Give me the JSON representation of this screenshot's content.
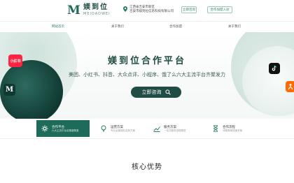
{
  "header": {
    "logo_mark": "M",
    "logo_cn": "媄到位",
    "logo_en": "MEIDAOWEI",
    "address_line1": "江西省吉安市新区",
    "address_line2": "吉安市媄到位信息科技有限公司",
    "btn_a": "立即咨询",
    "btn_b": "合作加盟入驻"
  },
  "nav": {
    "items": [
      "网站首页",
      "关于我们",
      "合作加盟",
      "关于我们"
    ]
  },
  "hero": {
    "title": "媄到位合作平台",
    "subtitle": "美团、小红书、抖音、大众点评、小程序、饿了么六大主流平台齐聚发力",
    "cta": "立即咨询",
    "badge_left_top": "小红书",
    "badge_left_bottom": "M"
  },
  "features": [
    {
      "title": "合作平台",
      "desc": "六大主流平台全渠道覆盖"
    },
    {
      "title": "运营方案",
      "desc": "专业运营团队定制方案"
    },
    {
      "title": "服务方案",
      "desc": "一站式服务全程跟进"
    },
    {
      "title": "合作流程",
      "desc": "流程简单快速对接"
    }
  ],
  "section": {
    "title": "核心优势"
  },
  "colors": {
    "brand": "#1f4c43",
    "accent": "#2a7f6a"
  }
}
